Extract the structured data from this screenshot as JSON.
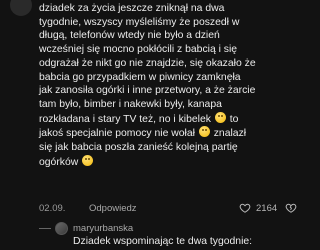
{
  "comment": {
    "lines": [
      "dziadek za życia jeszcze zniknął na dwa",
      "tygodnie, wszyscy myśleliśmy że poszedł w",
      "długą, telefonów wtedy nie było a dzień",
      "wcześniej się mocno pokłócili z babcią i się",
      "odgrażał że nikt go nie znajdzie, się okazało że",
      "babcia go przypadkiem w piwnicy zamknęła",
      "jak zanosiła ogórki i inne przetwory, a że żarcie",
      "tam było, bimber i nakewki były, kanapa",
      "rozkładana i stary TV też, no i kibelek",
      "to",
      "jakoś specjalnie pomocy nie wołał",
      "znalazł",
      "się jak babcia poszła zanieść kolejną partię",
      "ogórków"
    ],
    "emojis": [
      "laughing-face",
      "laughing-face",
      "laughing-face"
    ],
    "date": "02.09.",
    "reply_label": "Odpowiedz",
    "likes": "2164"
  },
  "reply": {
    "username": "maryurbanska",
    "text": "Dziadek wspominając te dwa tygodnie:"
  },
  "colors": {
    "background": "#121212",
    "text": "#ececec",
    "muted": "#9a9a9a"
  }
}
